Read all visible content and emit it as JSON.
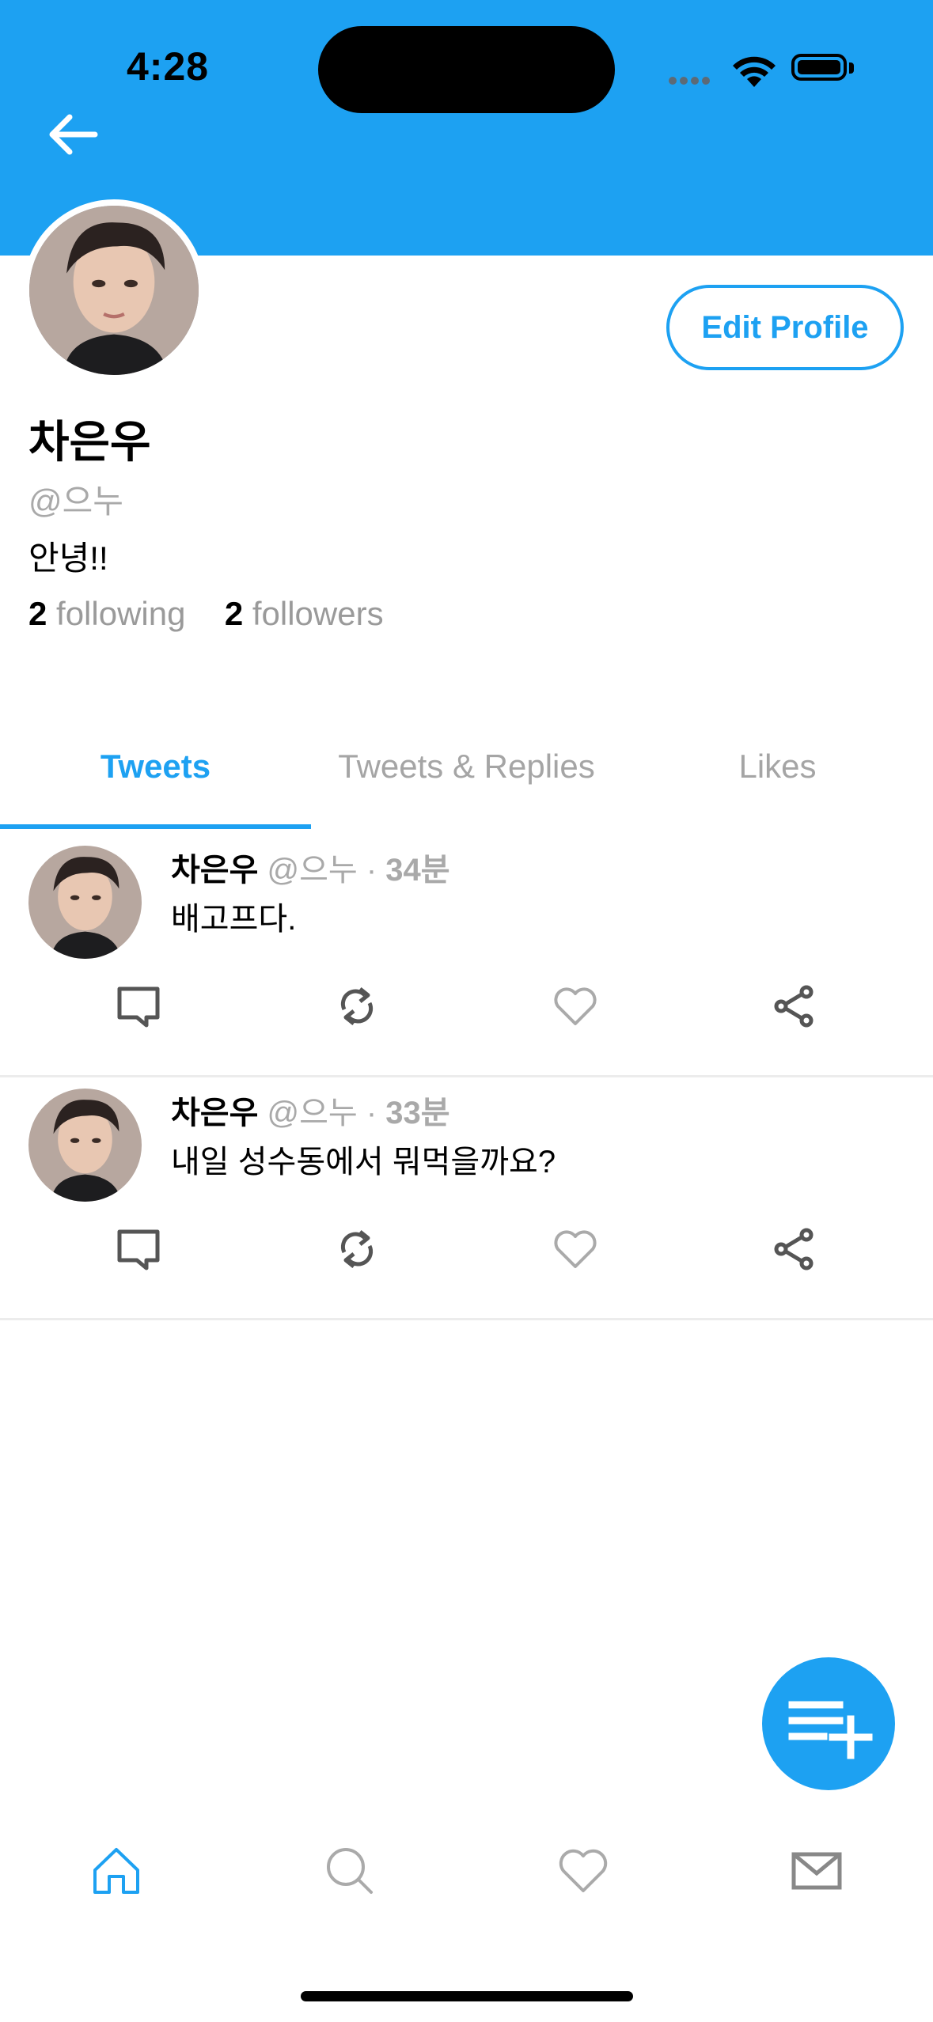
{
  "status_bar": {
    "time": "4:28"
  },
  "profile": {
    "name": "차은우",
    "handle": "@으누",
    "bio": "안녕!!",
    "following_count": "2",
    "following_label": "following",
    "followers_count": "2",
    "followers_label": "followers",
    "edit_button": "Edit Profile"
  },
  "tabs": [
    {
      "label": "Tweets",
      "active": true
    },
    {
      "label": "Tweets & Replies",
      "active": false
    },
    {
      "label": "Likes",
      "active": false
    }
  ],
  "tweets": [
    {
      "name": "차은우",
      "handle": "@으누",
      "separator": " · ",
      "time": "34분",
      "text": "배고프다."
    },
    {
      "name": "차은우",
      "handle": "@으누",
      "separator": " · ",
      "time": "33분",
      "text": "내일 성수동에서 뭐먹을까요?"
    }
  ],
  "colors": {
    "accent": "#1DA1F2",
    "muted": "#A9A9A9",
    "icon": "#555555"
  },
  "bottom_nav": [
    "home-icon",
    "search-icon",
    "heart-icon",
    "mail-icon"
  ]
}
